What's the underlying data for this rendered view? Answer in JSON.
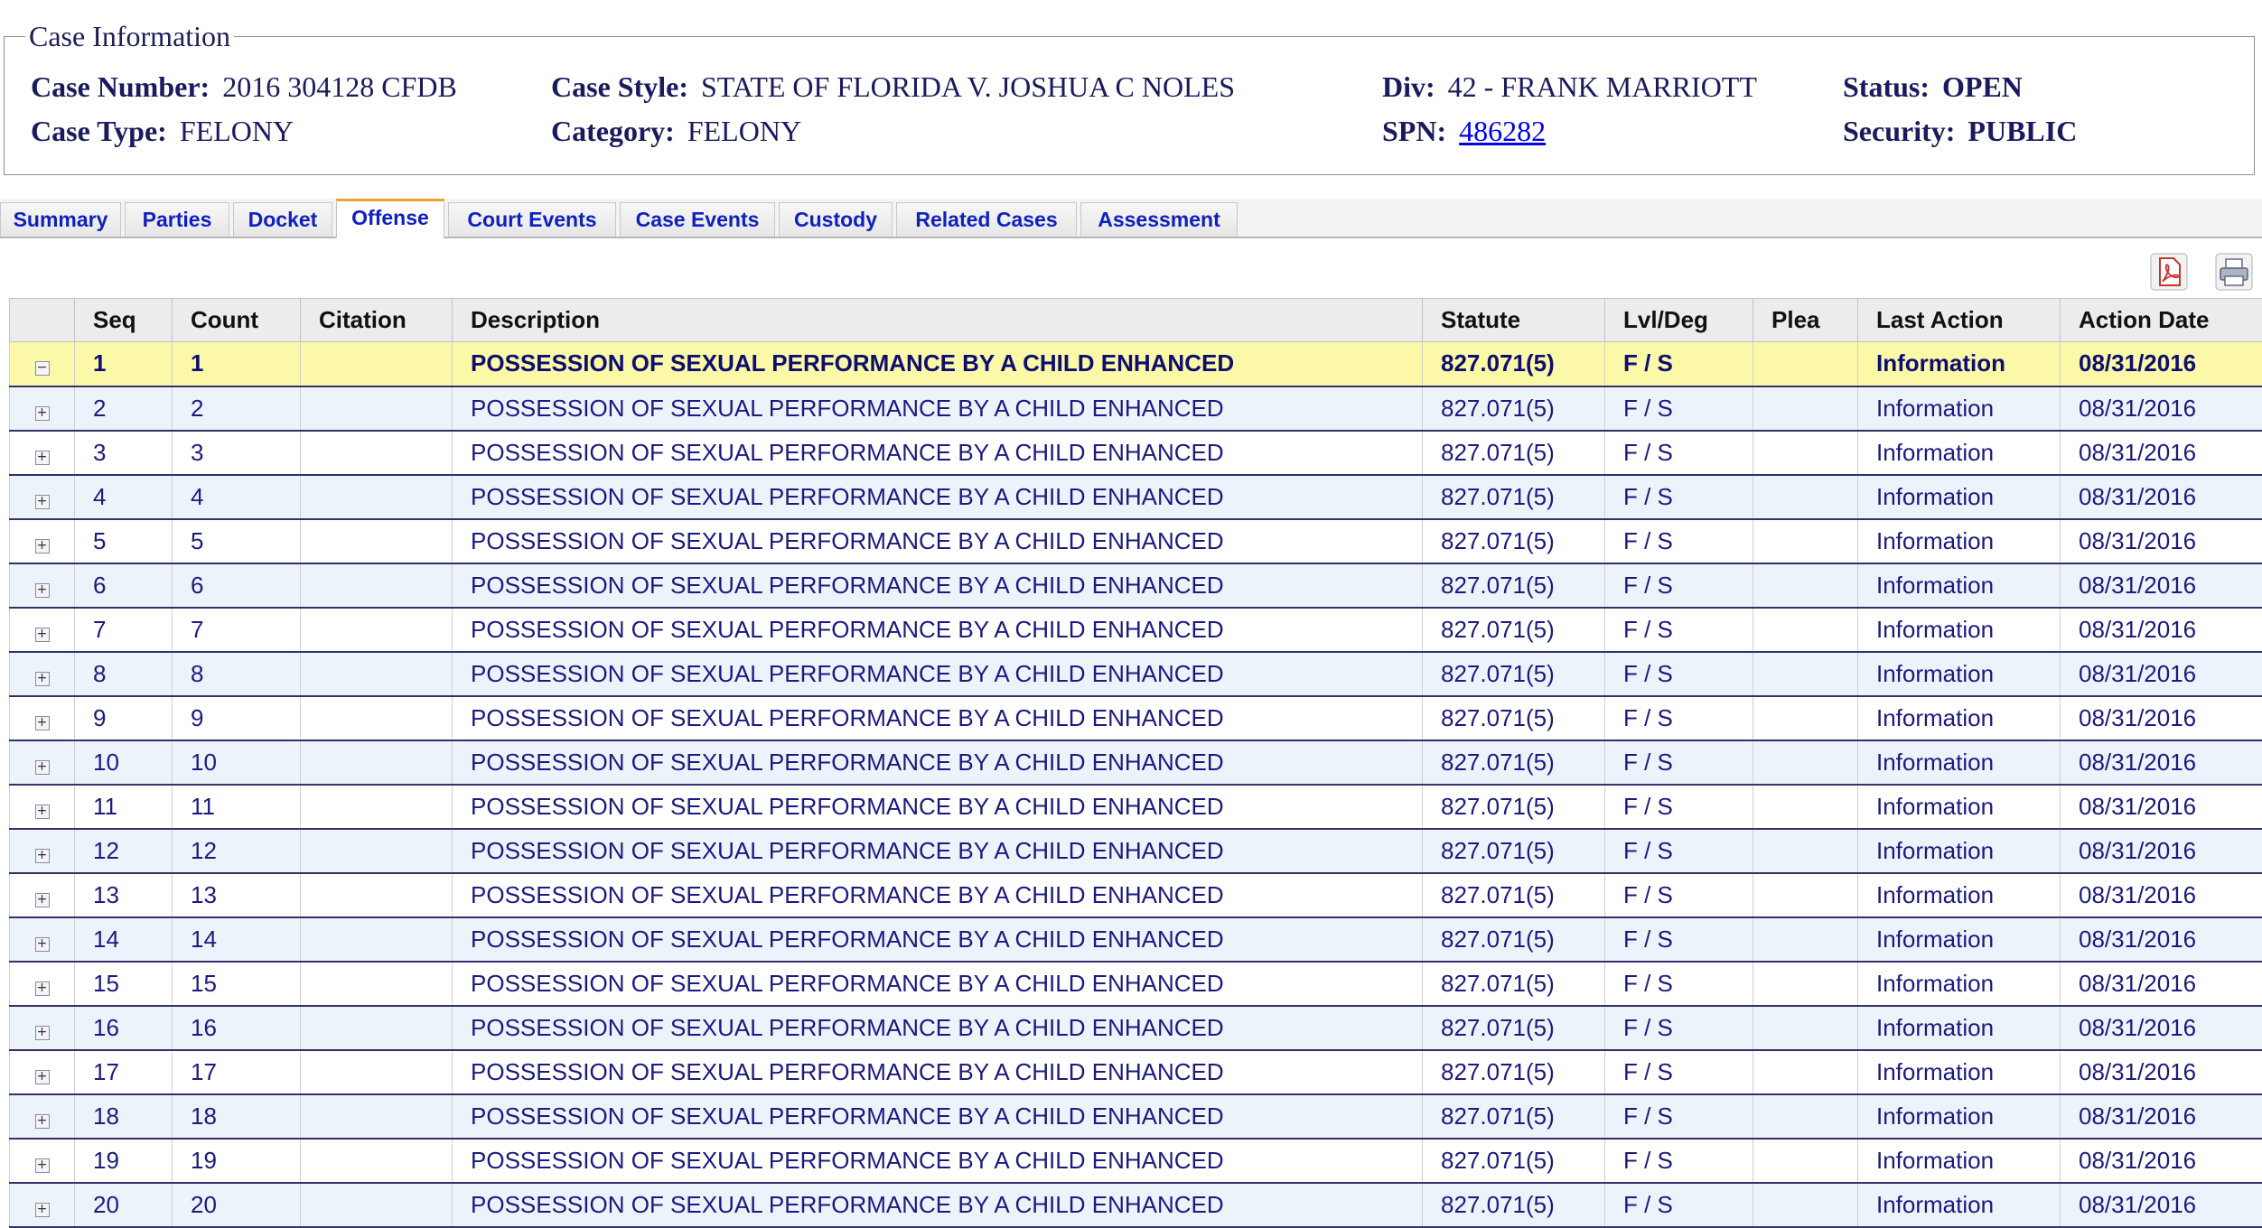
{
  "case_info": {
    "legend": "Case Information",
    "case_number_label": "Case Number:",
    "case_number": "2016 304128 CFDB",
    "case_type_label": "Case Type:",
    "case_type": "FELONY",
    "case_style_label": "Case Style:",
    "case_style": "STATE OF FLORIDA V. JOSHUA C NOLES",
    "category_label": "Category:",
    "category": "FELONY",
    "div_label": "Div:",
    "div": "42 - FRANK MARRIOTT",
    "spn_label": "SPN:",
    "spn": "486282",
    "status_label": "Status:",
    "status": "OPEN",
    "security_label": "Security:",
    "security": "PUBLIC"
  },
  "tabs": [
    "Summary",
    "Parties",
    "Docket",
    "Offense",
    "Court Events",
    "Case Events",
    "Custody",
    "Related Cases",
    "Assessment"
  ],
  "active_tab": "Offense",
  "toolbar": {
    "pdf_icon": "pdf-icon",
    "print_icon": "printer-icon"
  },
  "table": {
    "columns": [
      "",
      "Seq",
      "Count",
      "Citation",
      "Description",
      "Statute",
      "Lvl/Deg",
      "Plea",
      "Last Action",
      "Action Date"
    ],
    "rows": [
      {
        "seq": "1",
        "count": "1",
        "citation": "",
        "description": "POSSESSION OF SEXUAL PERFORMANCE BY A CHILD ENHANCED",
        "statute": "827.071(5)",
        "lvl": "F / S",
        "plea": "",
        "last_action": "Information",
        "action_date": "08/31/2016",
        "expanded": true
      },
      {
        "seq": "2",
        "count": "2",
        "citation": "",
        "description": "POSSESSION OF SEXUAL PERFORMANCE BY A CHILD ENHANCED",
        "statute": "827.071(5)",
        "lvl": "F / S",
        "plea": "",
        "last_action": "Information",
        "action_date": "08/31/2016"
      },
      {
        "seq": "3",
        "count": "3",
        "citation": "",
        "description": "POSSESSION OF SEXUAL PERFORMANCE BY A CHILD ENHANCED",
        "statute": "827.071(5)",
        "lvl": "F / S",
        "plea": "",
        "last_action": "Information",
        "action_date": "08/31/2016"
      },
      {
        "seq": "4",
        "count": "4",
        "citation": "",
        "description": "POSSESSION OF SEXUAL PERFORMANCE BY A CHILD ENHANCED",
        "statute": "827.071(5)",
        "lvl": "F / S",
        "plea": "",
        "last_action": "Information",
        "action_date": "08/31/2016"
      },
      {
        "seq": "5",
        "count": "5",
        "citation": "",
        "description": "POSSESSION OF SEXUAL PERFORMANCE BY A CHILD ENHANCED",
        "statute": "827.071(5)",
        "lvl": "F / S",
        "plea": "",
        "last_action": "Information",
        "action_date": "08/31/2016"
      },
      {
        "seq": "6",
        "count": "6",
        "citation": "",
        "description": "POSSESSION OF SEXUAL PERFORMANCE BY A CHILD ENHANCED",
        "statute": "827.071(5)",
        "lvl": "F / S",
        "plea": "",
        "last_action": "Information",
        "action_date": "08/31/2016"
      },
      {
        "seq": "7",
        "count": "7",
        "citation": "",
        "description": "POSSESSION OF SEXUAL PERFORMANCE BY A CHILD ENHANCED",
        "statute": "827.071(5)",
        "lvl": "F / S",
        "plea": "",
        "last_action": "Information",
        "action_date": "08/31/2016"
      },
      {
        "seq": "8",
        "count": "8",
        "citation": "",
        "description": "POSSESSION OF SEXUAL PERFORMANCE BY A CHILD ENHANCED",
        "statute": "827.071(5)",
        "lvl": "F / S",
        "plea": "",
        "last_action": "Information",
        "action_date": "08/31/2016"
      },
      {
        "seq": "9",
        "count": "9",
        "citation": "",
        "description": "POSSESSION OF SEXUAL PERFORMANCE BY A CHILD ENHANCED",
        "statute": "827.071(5)",
        "lvl": "F / S",
        "plea": "",
        "last_action": "Information",
        "action_date": "08/31/2016"
      },
      {
        "seq": "10",
        "count": "10",
        "citation": "",
        "description": "POSSESSION OF SEXUAL PERFORMANCE BY A CHILD ENHANCED",
        "statute": "827.071(5)",
        "lvl": "F / S",
        "plea": "",
        "last_action": "Information",
        "action_date": "08/31/2016"
      },
      {
        "seq": "11",
        "count": "11",
        "citation": "",
        "description": "POSSESSION OF SEXUAL PERFORMANCE BY A CHILD ENHANCED",
        "statute": "827.071(5)",
        "lvl": "F / S",
        "plea": "",
        "last_action": "Information",
        "action_date": "08/31/2016"
      },
      {
        "seq": "12",
        "count": "12",
        "citation": "",
        "description": "POSSESSION OF SEXUAL PERFORMANCE BY A CHILD ENHANCED",
        "statute": "827.071(5)",
        "lvl": "F / S",
        "plea": "",
        "last_action": "Information",
        "action_date": "08/31/2016"
      },
      {
        "seq": "13",
        "count": "13",
        "citation": "",
        "description": "POSSESSION OF SEXUAL PERFORMANCE BY A CHILD ENHANCED",
        "statute": "827.071(5)",
        "lvl": "F / S",
        "plea": "",
        "last_action": "Information",
        "action_date": "08/31/2016"
      },
      {
        "seq": "14",
        "count": "14",
        "citation": "",
        "description": "POSSESSION OF SEXUAL PERFORMANCE BY A CHILD ENHANCED",
        "statute": "827.071(5)",
        "lvl": "F / S",
        "plea": "",
        "last_action": "Information",
        "action_date": "08/31/2016"
      },
      {
        "seq": "15",
        "count": "15",
        "citation": "",
        "description": "POSSESSION OF SEXUAL PERFORMANCE BY A CHILD ENHANCED",
        "statute": "827.071(5)",
        "lvl": "F / S",
        "plea": "",
        "last_action": "Information",
        "action_date": "08/31/2016"
      },
      {
        "seq": "16",
        "count": "16",
        "citation": "",
        "description": "POSSESSION OF SEXUAL PERFORMANCE BY A CHILD ENHANCED",
        "statute": "827.071(5)",
        "lvl": "F / S",
        "plea": "",
        "last_action": "Information",
        "action_date": "08/31/2016"
      },
      {
        "seq": "17",
        "count": "17",
        "citation": "",
        "description": "POSSESSION OF SEXUAL PERFORMANCE BY A CHILD ENHANCED",
        "statute": "827.071(5)",
        "lvl": "F / S",
        "plea": "",
        "last_action": "Information",
        "action_date": "08/31/2016"
      },
      {
        "seq": "18",
        "count": "18",
        "citation": "",
        "description": "POSSESSION OF SEXUAL PERFORMANCE BY A CHILD ENHANCED",
        "statute": "827.071(5)",
        "lvl": "F / S",
        "plea": "",
        "last_action": "Information",
        "action_date": "08/31/2016"
      },
      {
        "seq": "19",
        "count": "19",
        "citation": "",
        "description": "POSSESSION OF SEXUAL PERFORMANCE BY A CHILD ENHANCED",
        "statute": "827.071(5)",
        "lvl": "F / S",
        "plea": "",
        "last_action": "Information",
        "action_date": "08/31/2016"
      },
      {
        "seq": "20",
        "count": "20",
        "citation": "",
        "description": "POSSESSION OF SEXUAL PERFORMANCE BY A CHILD ENHANCED",
        "statute": "827.071(5)",
        "lvl": "F / S",
        "plea": "",
        "last_action": "Information",
        "action_date": "08/31/2016"
      }
    ]
  },
  "colors": {
    "link": "#0000ee",
    "selected_row": "#fbf8a8",
    "active_tab_accent": "#f0a030",
    "tab_text": "#1020c0"
  }
}
